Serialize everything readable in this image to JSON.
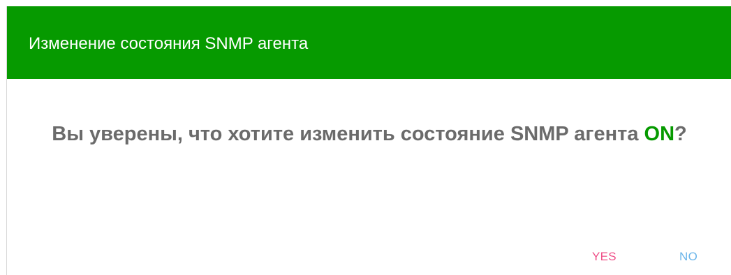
{
  "dialog": {
    "title": "Изменение состояния SNMP агента",
    "message_prefix": "Вы уверены, что хотите изменить состояние SNMP агента ",
    "state_value": "ON",
    "message_suffix": "?",
    "yes_label": "YES",
    "no_label": "NO"
  },
  "colors": {
    "header_bg": "#069a00",
    "state_text": "#069a00",
    "message_text": "#6b6b6b",
    "yes_text": "#ef4f88",
    "no_text": "#6bb5ea"
  }
}
